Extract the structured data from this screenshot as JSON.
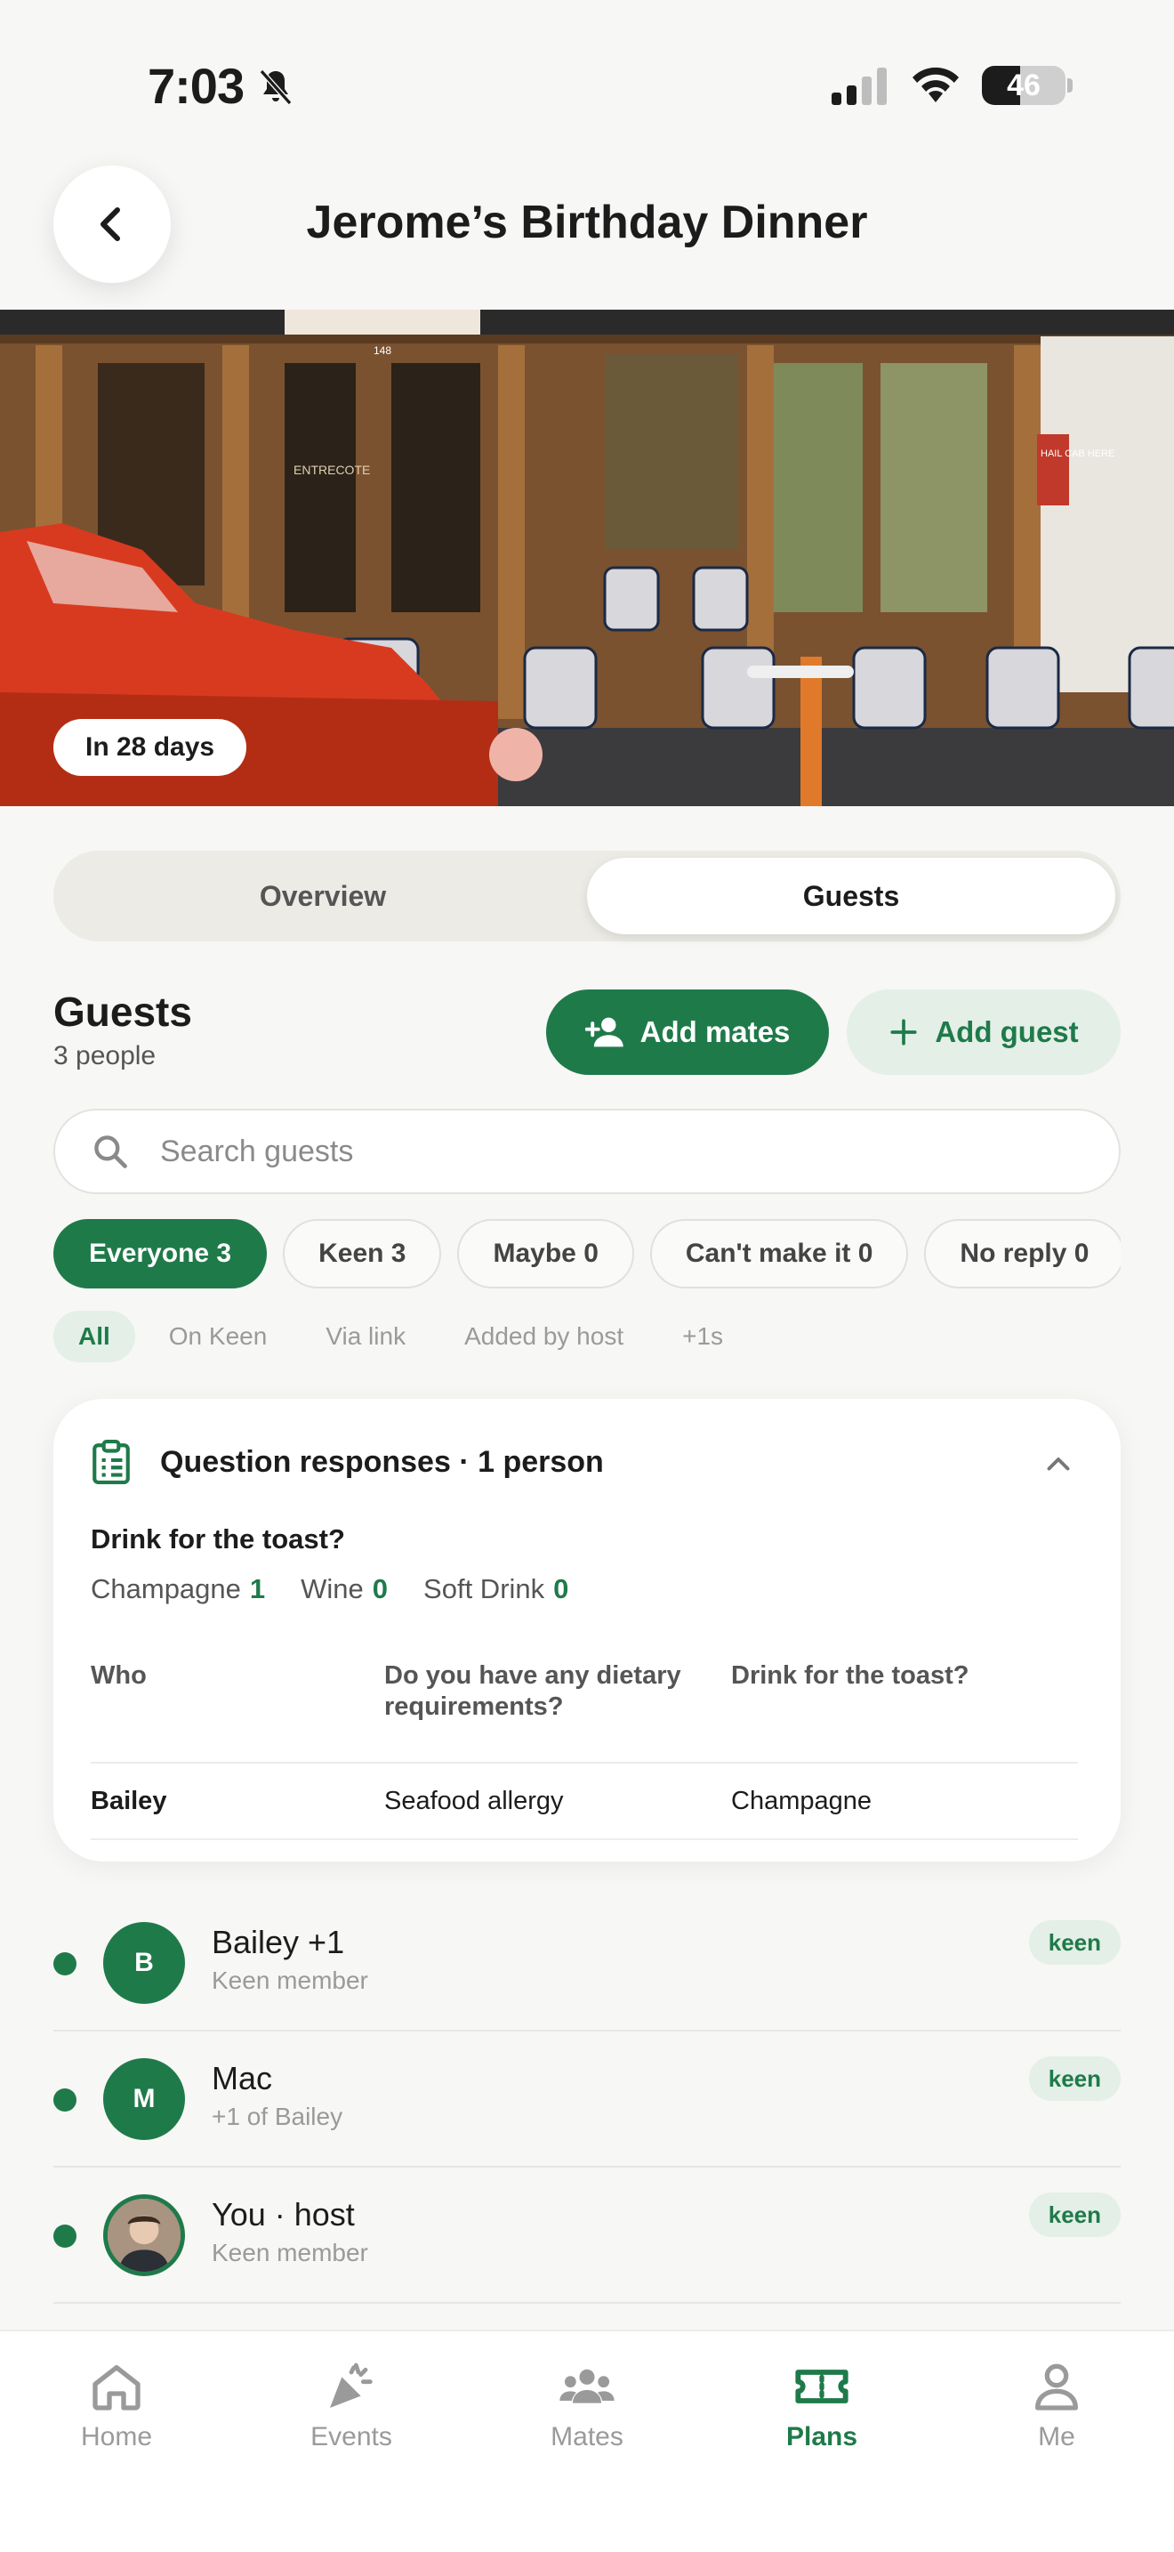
{
  "status_bar": {
    "time": "7:03",
    "battery": "46"
  },
  "header": {
    "title": "Jerome’s Birthday Dinner"
  },
  "hero": {
    "badge": "In 28 days",
    "sign_number": "148",
    "door_sign": "ENTRECOTE",
    "side_sign": "HAIL CAB HERE"
  },
  "segmented": {
    "overview": "Overview",
    "guests": "Guests",
    "selected": "Guests"
  },
  "guests_section": {
    "title": "Guests",
    "count": "3 people",
    "add_mates": "Add mates",
    "add_guest": "Add guest"
  },
  "search": {
    "placeholder": "Search guests",
    "value": ""
  },
  "status_filters": [
    {
      "label": "Everyone 3",
      "active": true
    },
    {
      "label": "Keen 3",
      "active": false
    },
    {
      "label": "Maybe 0",
      "active": false
    },
    {
      "label": "Can't make it 0",
      "active": false
    },
    {
      "label": "No reply 0",
      "active": false
    }
  ],
  "source_filters": [
    {
      "label": "All",
      "active": true
    },
    {
      "label": "On Keen",
      "active": false
    },
    {
      "label": "Via link",
      "active": false
    },
    {
      "label": "Added by host",
      "active": false
    },
    {
      "label": "+1s",
      "active": false
    }
  ],
  "question_card": {
    "title": "Question responses · 1 person",
    "question": "Drink for the toast?",
    "tallies": [
      {
        "label": "Champagne",
        "count": "1"
      },
      {
        "label": "Wine",
        "count": "0"
      },
      {
        "label": "Soft Drink",
        "count": "0"
      }
    ],
    "columns": [
      "Who",
      "Do you have any dietary requirements?",
      "Drink for the toast?"
    ],
    "rows": [
      {
        "who": "Bailey",
        "dietary": "Seafood allergy",
        "drink": "Champagne"
      }
    ]
  },
  "guest_list": [
    {
      "initial": "B",
      "name": "Bailey +1",
      "sub": "Keen member",
      "badge": "keen"
    },
    {
      "initial": "M",
      "name": "Mac",
      "sub": "+1 of Bailey",
      "badge": "keen"
    },
    {
      "initial": "",
      "name": "You · host",
      "sub": "Keen member",
      "badge": "keen"
    }
  ],
  "tabbar": {
    "items": [
      {
        "label": "Home",
        "icon": "home-icon"
      },
      {
        "label": "Events",
        "icon": "party-popper-icon"
      },
      {
        "label": "Mates",
        "icon": "people-icon"
      },
      {
        "label": "Plans",
        "icon": "ticket-icon"
      },
      {
        "label": "Me",
        "icon": "person-icon"
      }
    ],
    "active": "Plans"
  },
  "colors": {
    "brand": "#1f7a4a",
    "brand_light": "#e3efe7",
    "background": "#f7f7f5"
  }
}
